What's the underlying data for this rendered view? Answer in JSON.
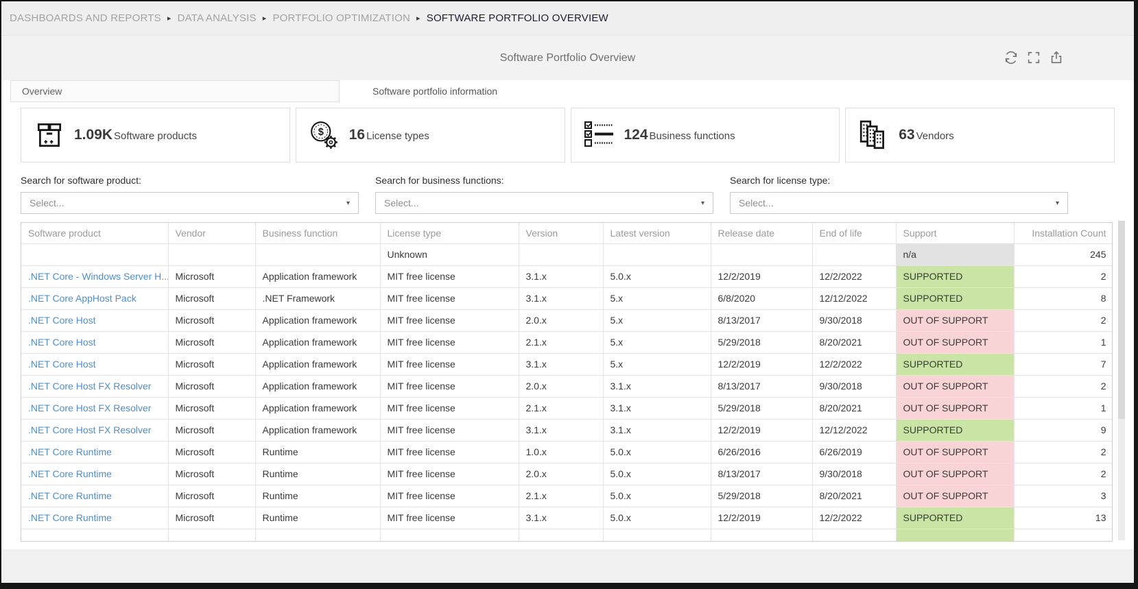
{
  "breadcrumb": {
    "separator": "▸",
    "items": [
      "DASHBOARDS AND REPORTS",
      "DATA ANALYSIS",
      "PORTFOLIO OPTIMIZATION",
      "SOFTWARE PORTFOLIO OVERVIEW"
    ]
  },
  "header": {
    "title": "Software Portfolio Overview",
    "icons": [
      "refresh-icon",
      "fullscreen-icon",
      "export-icon"
    ]
  },
  "tabs": [
    {
      "label": "Overview",
      "active": false
    },
    {
      "label": "Software portfolio information",
      "active": true
    }
  ],
  "kpis": [
    {
      "icon": "package-icon",
      "value": "1.09K",
      "label": "Software products"
    },
    {
      "icon": "coin-gear-icon",
      "value": "16",
      "label": "License types"
    },
    {
      "icon": "checklist-icon",
      "value": "124",
      "label": "Business functions"
    },
    {
      "icon": "buildings-icon",
      "value": "63",
      "label": "Vendors"
    }
  ],
  "filters": [
    {
      "label": "Search for software product:",
      "placeholder": "Select...",
      "caret": "▾"
    },
    {
      "label": "Search for business functions:",
      "placeholder": "Select...",
      "caret": "▾"
    },
    {
      "label": "Search for license type:",
      "placeholder": "Select...",
      "caret": "▾"
    }
  ],
  "colors": {
    "supported_bg": "#c9e4a4",
    "out_of_support_bg": "#f9d4d7",
    "na_bg": "#e2e2e2",
    "link_color": "#4a90d2"
  },
  "table": {
    "columns": [
      "Software product",
      "Vendor",
      "Business function",
      "License type",
      "Version",
      "Latest version",
      "Release date",
      "End of life",
      "Support",
      "Installation Count"
    ],
    "column_keys": [
      "software-product",
      "vendor",
      "business-function",
      "license-type",
      "version",
      "latest-version",
      "release-date",
      "end-of-life",
      "support",
      "installation-count"
    ],
    "rows": [
      {
        "cells": [
          "",
          "",
          "",
          "Unknown",
          "",
          "",
          "",
          "",
          "n/a",
          "245"
        ],
        "support": "na",
        "link": false
      },
      {
        "cells": [
          ".NET Core - Windows Server H...",
          "Microsoft",
          "Application framework",
          "MIT free license",
          "3.1.x",
          "5.0.x",
          "12/2/2019",
          "12/2/2022",
          "SUPPORTED",
          "2"
        ],
        "support": "supported",
        "link": true
      },
      {
        "cells": [
          ".NET Core AppHost Pack",
          "Microsoft",
          ".NET Framework",
          "MIT free license",
          "3.1.x",
          "5.x",
          "6/8/2020",
          "12/12/2022",
          "SUPPORTED",
          "8"
        ],
        "support": "supported",
        "link": true
      },
      {
        "cells": [
          ".NET Core Host",
          "Microsoft",
          "Application framework",
          "MIT free license",
          "2.0.x",
          "5.x",
          "8/13/2017",
          "9/30/2018",
          "OUT OF SUPPORT",
          "2"
        ],
        "support": "out",
        "link": true
      },
      {
        "cells": [
          ".NET Core Host",
          "Microsoft",
          "Application framework",
          "MIT free license",
          "2.1.x",
          "5.x",
          "5/29/2018",
          "8/20/2021",
          "OUT OF SUPPORT",
          "1"
        ],
        "support": "out",
        "link": true
      },
      {
        "cells": [
          ".NET Core Host",
          "Microsoft",
          "Application framework",
          "MIT free license",
          "3.1.x",
          "5.x",
          "12/2/2019",
          "12/2/2022",
          "SUPPORTED",
          "7"
        ],
        "support": "supported",
        "link": true
      },
      {
        "cells": [
          ".NET Core Host FX Resolver",
          "Microsoft",
          "Application framework",
          "MIT free license",
          "2.0.x",
          "3.1.x",
          "8/13/2017",
          "9/30/2018",
          "OUT OF SUPPORT",
          "2"
        ],
        "support": "out",
        "link": true
      },
      {
        "cells": [
          ".NET Core Host FX Resolver",
          "Microsoft",
          "Application framework",
          "MIT free license",
          "2.1.x",
          "3.1.x",
          "5/29/2018",
          "8/20/2021",
          "OUT OF SUPPORT",
          "1"
        ],
        "support": "out",
        "link": true
      },
      {
        "cells": [
          ".NET Core Host FX Resolver",
          "Microsoft",
          "Application framework",
          "MIT free license",
          "3.1.x",
          "3.1.x",
          "12/2/2019",
          "12/12/2022",
          "SUPPORTED",
          "9"
        ],
        "support": "supported",
        "link": true
      },
      {
        "cells": [
          ".NET Core Runtime",
          "Microsoft",
          "Runtime",
          "MIT free license",
          "1.0.x",
          "5.0.x",
          "6/26/2016",
          "6/26/2019",
          "OUT OF SUPPORT",
          "2"
        ],
        "support": "out",
        "link": true
      },
      {
        "cells": [
          ".NET Core Runtime",
          "Microsoft",
          "Runtime",
          "MIT free license",
          "2.0.x",
          "5.0.x",
          "8/13/2017",
          "9/30/2018",
          "OUT OF SUPPORT",
          "2"
        ],
        "support": "out",
        "link": true
      },
      {
        "cells": [
          ".NET Core Runtime",
          "Microsoft",
          "Runtime",
          "MIT free license",
          "2.1.x",
          "5.0.x",
          "5/29/2018",
          "8/20/2021",
          "OUT OF SUPPORT",
          "3"
        ],
        "support": "out",
        "link": true
      },
      {
        "cells": [
          ".NET Core Runtime",
          "Microsoft",
          "Runtime",
          "MIT free license",
          "3.1.x",
          "5.0.x",
          "12/2/2019",
          "12/2/2022",
          "SUPPORTED",
          "13"
        ],
        "support": "supported",
        "link": true
      },
      {
        "cells": [
          "",
          "",
          "",
          "",
          "",
          "",
          "",
          "",
          "",
          ""
        ],
        "support": "supported",
        "link": false
      }
    ]
  }
}
